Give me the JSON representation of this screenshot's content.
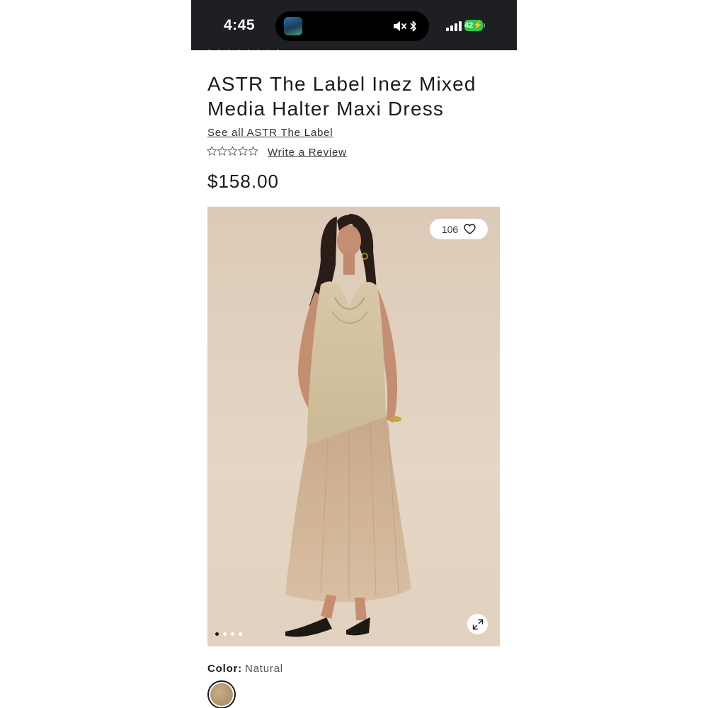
{
  "status_bar": {
    "time": "4:45",
    "battery": "42",
    "icons": [
      "app-icon",
      "mute-icon",
      "bluetooth-icon",
      "cellular-signal-icon",
      "charging-battery-icon"
    ]
  },
  "product": {
    "title": "ASTR The Label Inez Mixed Media Halter Maxi Dress",
    "brand_link": "See all ASTR The Label",
    "rating_stars": 0,
    "review_link": "Write a Review",
    "price": "$158.00"
  },
  "gallery": {
    "likes": "106",
    "image_count": 4,
    "active_index": 0
  },
  "color": {
    "label": "Color:",
    "value": "Natural",
    "swatch_color": "#b3956f"
  },
  "colors": {
    "status_bar_bg": "#1e1f22",
    "battery_green": "#30c651",
    "photo_backdrop": "#e2d1be"
  }
}
